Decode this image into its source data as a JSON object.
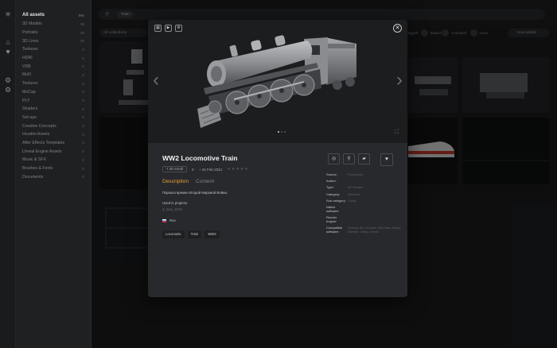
{
  "sidebar": {
    "header": {
      "label": "All assets",
      "count": "890"
    },
    "items": [
      {
        "label": "3D Models",
        "count": "00"
      },
      {
        "label": "Portraits",
        "count": "00"
      },
      {
        "label": "3D Lines",
        "count": "00"
      },
      {
        "label": "Textures",
        "count": "0"
      },
      {
        "label": "HDRI",
        "count": "0"
      },
      {
        "label": "VDB",
        "count": "0"
      },
      {
        "label": "MoD",
        "count": "0"
      },
      {
        "label": "Textures",
        "count": "0"
      },
      {
        "label": "MoCap",
        "count": "0"
      },
      {
        "label": "PLY",
        "count": "0"
      },
      {
        "label": "Shaders",
        "count": "0"
      },
      {
        "label": "Set-ups",
        "count": "0"
      },
      {
        "label": "Creative Concepts",
        "count": "0"
      },
      {
        "label": "Houdini Assets",
        "count": "0"
      },
      {
        "label": "After Effects Templates",
        "count": "0"
      },
      {
        "label": "Unreal Engine Assets",
        "count": "0"
      },
      {
        "label": "Music & SFX",
        "count": "0"
      },
      {
        "label": "Brushes & Fonts",
        "count": "0"
      },
      {
        "label": "Documents",
        "count": "0"
      }
    ]
  },
  "search": {
    "chip": "Train"
  },
  "filters": {
    "collections": "All collections",
    "toggles": [
      "Rigged",
      "Baked",
      "Animated",
      "Lens"
    ],
    "sort": "New added"
  },
  "modal": {
    "title": "WW2 Locomotive Train",
    "file_size": "7.30 small",
    "views": "0",
    "date": "24 Feb 2021",
    "stars": "★★★★★",
    "tabs": {
      "description": "Description",
      "content": "Content"
    },
    "description": "Паровоз времен Второй Мировой Войны",
    "used_in_label": "Used in projects:",
    "used_in_value": "3_max_2016",
    "language": "Rus",
    "tags": [
      "Locomotiv",
      "Train",
      "WW2"
    ],
    "properties": [
      {
        "key": "Source:",
        "value": "Purchased"
      },
      {
        "key": "Author:",
        "value": "-"
      },
      {
        "key": "Type:",
        "value": "3D Models"
      },
      {
        "key": "Category:",
        "value": "Vehicles"
      },
      {
        "key": "Sub category:",
        "value": "Trains"
      },
      {
        "key": "Native software:",
        "value": "-"
      },
      {
        "key": "Render engine:",
        "value": "-"
      },
      {
        "key": "Compatible software:",
        "value": "Cinema 4D, Houdini, 3Ds Max, Maya, Blender, Unity, Unreal"
      }
    ],
    "icons": {
      "grid": "▦",
      "play": "▶",
      "settings": "⚙",
      "close": "✕",
      "prev": "‹",
      "next": "›",
      "fullscreen": "⛶",
      "view": "◎",
      "link": "⚲",
      "folder": "▰",
      "heart": "♥"
    }
  },
  "colors": {
    "accent": "#e4a23a",
    "modal_bg": "#28292c",
    "viewer_bg": "#1c1d1f"
  }
}
